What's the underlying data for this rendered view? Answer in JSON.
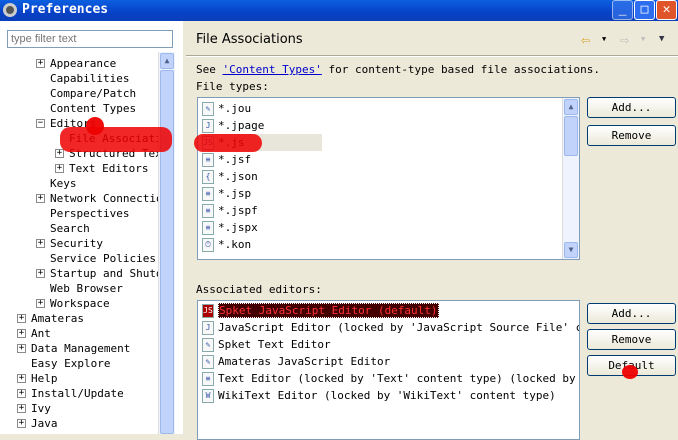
{
  "window": {
    "title": "Preferences"
  },
  "filter": {
    "placeholder": "type filter text"
  },
  "tree": [
    {
      "label": "Appearance",
      "level": 1,
      "exp": "+"
    },
    {
      "label": "Capabilities",
      "level": 1,
      "exp": ""
    },
    {
      "label": "Compare/Patch",
      "level": 1,
      "exp": ""
    },
    {
      "label": "Content Types",
      "level": 1,
      "exp": ""
    },
    {
      "label": "Editors",
      "level": 1,
      "exp": "-"
    },
    {
      "label": "File Associations",
      "level": 2,
      "exp": ""
    },
    {
      "label": "Structured Text Editors",
      "level": 2,
      "exp": "+"
    },
    {
      "label": "Text Editors",
      "level": 2,
      "exp": "+"
    },
    {
      "label": "Keys",
      "level": 1,
      "exp": ""
    },
    {
      "label": "Network Connections",
      "level": 1,
      "exp": "+"
    },
    {
      "label": "Perspectives",
      "level": 1,
      "exp": ""
    },
    {
      "label": "Search",
      "level": 1,
      "exp": ""
    },
    {
      "label": "Security",
      "level": 1,
      "exp": "+"
    },
    {
      "label": "Service Policies",
      "level": 1,
      "exp": ""
    },
    {
      "label": "Startup and Shutdown",
      "level": 1,
      "exp": "+"
    },
    {
      "label": "Web Browser",
      "level": 1,
      "exp": ""
    },
    {
      "label": "Workspace",
      "level": 1,
      "exp": "+"
    },
    {
      "label": "Amateras",
      "level": 0,
      "exp": "+"
    },
    {
      "label": "Ant",
      "level": 0,
      "exp": "+"
    },
    {
      "label": "Data Management",
      "level": 0,
      "exp": "+"
    },
    {
      "label": "Easy Explore",
      "level": 0,
      "exp": ""
    },
    {
      "label": "Help",
      "level": 0,
      "exp": "+"
    },
    {
      "label": "Install/Update",
      "level": 0,
      "exp": "+"
    },
    {
      "label": "Ivy",
      "level": 0,
      "exp": "+"
    },
    {
      "label": "Java",
      "level": 0,
      "exp": "+"
    }
  ],
  "page": {
    "title": "File Associations",
    "see": "See ",
    "link": "'Content Types'",
    "see_rest": " for content-type based file associations.",
    "file_types_label": "File types:",
    "editors_label": "Associated editors:"
  },
  "file_types": [
    {
      "name": "*.jou",
      "icon": "scroll"
    },
    {
      "name": "*.jpage",
      "icon": "J"
    },
    {
      "name": "*.js",
      "icon": "js"
    },
    {
      "name": "*.jsf",
      "icon": "doc"
    },
    {
      "name": "*.json",
      "icon": "json"
    },
    {
      "name": "*.jsp",
      "icon": "doc"
    },
    {
      "name": "*.jspf",
      "icon": "doc"
    },
    {
      "name": "*.jspx",
      "icon": "doc"
    },
    {
      "name": "*.kon",
      "icon": "clock"
    }
  ],
  "editors": [
    "Spket JavaScript Editor (default)",
    "JavaScript Editor (locked by 'JavaScript Source File' content type)",
    "Spket Text Editor",
    "Amateras JavaScript Editor",
    "Text Editor (locked by 'Text' content type) (locked by 'JavaScript Source File' content type)",
    "WikiText Editor (locked by 'WikiText' content type)"
  ],
  "buttons": {
    "add": "Add...",
    "remove": "Remove",
    "default": "Default"
  }
}
